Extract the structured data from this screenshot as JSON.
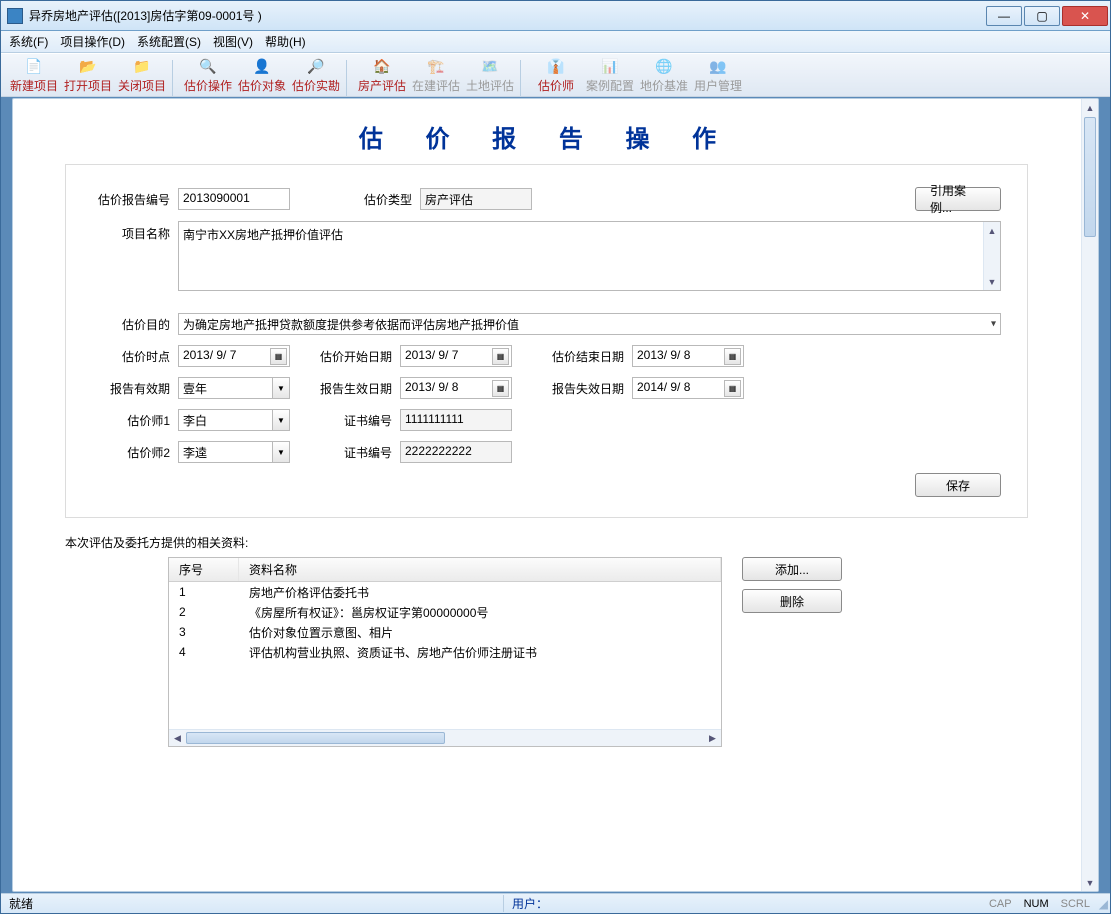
{
  "window": {
    "title": "异乔房地产评估([2013]房估字第09-0001号 )"
  },
  "menu": {
    "system": "系统(F)",
    "project": "项目操作(D)",
    "config": "系统配置(S)",
    "view": "视图(V)",
    "help": "帮助(H)"
  },
  "toolbar": {
    "new": "新建项目",
    "open": "打开项目",
    "close": "关闭项目",
    "op": "估价操作",
    "obj": "估价对象",
    "survey": "估价实勘",
    "house": "房产评估",
    "building": "在建评估",
    "land": "土地评估",
    "appraiser": "估价师",
    "case": "案例配置",
    "landbase": "地价基准",
    "user": "用户管理"
  },
  "page": {
    "title": "估 价 报 告 操 作"
  },
  "form": {
    "reportNo_label": "估价报告编号",
    "reportNo": "2013090001",
    "type_label": "估价类型",
    "type": "房产评估",
    "refCase_btn": "引用案例...",
    "projName_label": "项目名称",
    "projName": "南宁市XX房地产抵押价值评估",
    "purpose_label": "估价目的",
    "purpose": "为确定房地产抵押贷款额度提供参考依据而评估房地产抵押价值",
    "point_label": "估价时点",
    "point": "2013/ 9/ 7",
    "start_label": "估价开始日期",
    "start": "2013/ 9/ 7",
    "end_label": "估价结束日期",
    "end": "2013/ 9/ 8",
    "valid_label": "报告有效期",
    "valid": "壹年",
    "effect_label": "报告生效日期",
    "effect": "2013/ 9/ 8",
    "expire_label": "报告失效日期",
    "expire": "2014/ 9/ 8",
    "appr1_label": "估价师1",
    "appr1": "李白",
    "cert1_label": "证书编号",
    "cert1": "1111111111",
    "appr2_label": "估价师2",
    "appr2": "李逵",
    "cert2_label": "证书编号",
    "cert2": "2222222222",
    "save_btn": "保存"
  },
  "materials": {
    "label": "本次评估及委托方提供的相关资料:",
    "col_no": "序号",
    "col_name": "资料名称",
    "rows": [
      {
        "no": "1",
        "name": "房地产价格评估委托书"
      },
      {
        "no": "2",
        "name": "《房屋所有权证》：邕房权证字第00000000号"
      },
      {
        "no": "3",
        "name": "估价对象位置示意图、相片"
      },
      {
        "no": "4",
        "name": "评估机构营业执照、资质证书、房地产估价师注册证书"
      }
    ],
    "add_btn": "添加...",
    "del_btn": "删除"
  },
  "status": {
    "ready": "就绪",
    "user_label": "用户：",
    "cap": "CAP",
    "num": "NUM",
    "scrl": "SCRL"
  }
}
